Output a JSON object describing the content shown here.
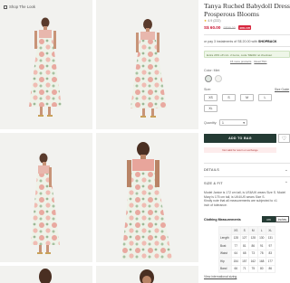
{
  "gallery": {
    "shop_the_look": "Shop The Look",
    "photos": [
      {
        "name": "photo-front-full"
      },
      {
        "name": "photo-back-full"
      },
      {
        "name": "photo-side-full"
      },
      {
        "name": "photo-front-closeup"
      },
      {
        "name": "photo-detail-left"
      },
      {
        "name": "photo-detail-right"
      }
    ]
  },
  "product": {
    "title_line1": "Tanya Ruched Babydoll Dress in",
    "title_line2": "Prosperous Blooms",
    "rating": "4.9",
    "review_count": "(222)",
    "price_now": "S$ 60.00",
    "price_old": "S$99.00",
    "discount_badge": "40% Off"
  },
  "installment": {
    "text": "or pay 3 instalments of S$ 20.00 with",
    "provider": "SHOPBACK"
  },
  "promo": {
    "text": "Extra 20% off min. 2 items, code 'MERA' at checkout",
    "link1": "15 more products",
    "link2": "Read TNC"
  },
  "color": {
    "label": "Color: Mint"
  },
  "size": {
    "label": "Size:",
    "guide": "Size Guide",
    "options": [
      "XS",
      "S",
      "M",
      "L",
      "XL"
    ]
  },
  "quantity": {
    "label": "Quantity:",
    "value": "1"
  },
  "actions": {
    "add_to_bag": "ADD TO BAG",
    "wishlist_icon": "heart-icon",
    "returns_note": "Not valid for return or exchange"
  },
  "sections": {
    "details": "DETAILS",
    "size_fit": "SIZE & FIT"
  },
  "description": [
    "Model Janice is 172 cm tall, is US6/UK wears Size S. Model",
    "Mary is 175 cm tall, is UK4/US wears Size S.",
    "Kindly note that all measurements are subjected to ±1",
    "inch of tolerance."
  ],
  "measurements": {
    "title": "Clothing Measurements",
    "unit_active": "cm",
    "unit_inactive": "inches",
    "columns": [
      "XS",
      "S",
      "M",
      "L",
      "XL"
    ],
    "rows": [
      {
        "label": "Length",
        "values": [
          "128",
          "127",
          "128",
          "130",
          "131"
        ]
      },
      {
        "label": "Bust",
        "values": [
          "77",
          "81",
          "86",
          "91",
          "97"
        ]
      },
      {
        "label": "Waist",
        "values": [
          "64",
          "68",
          "73",
          "78",
          "83"
        ]
      },
      {
        "label": "Hip",
        "values": [
          "154",
          "157",
          "162",
          "168",
          "177"
        ]
      },
      {
        "label": "Band",
        "values": [
          "66",
          "71",
          "75",
          "80",
          "86"
        ]
      }
    ]
  },
  "footer_link": "View international sizing",
  "colors": {
    "accent_dark": "#243b34",
    "price_red": "#c8102e",
    "badge_red": "#d7263d"
  }
}
